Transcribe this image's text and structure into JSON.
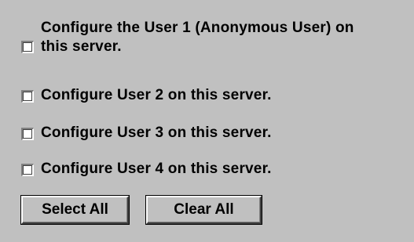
{
  "options": [
    {
      "line1": "Configure the User 1 (Anonymous User) on",
      "line2": "this server.",
      "checked": false
    },
    {
      "label": "Configure User 2 on this server.",
      "checked": false
    },
    {
      "label": "Configure User 3 on this server.",
      "checked": false
    },
    {
      "label": "Configure User 4 on this server.",
      "checked": false
    }
  ],
  "buttons": {
    "select_all": "Select All",
    "clear_all": "Clear All"
  }
}
